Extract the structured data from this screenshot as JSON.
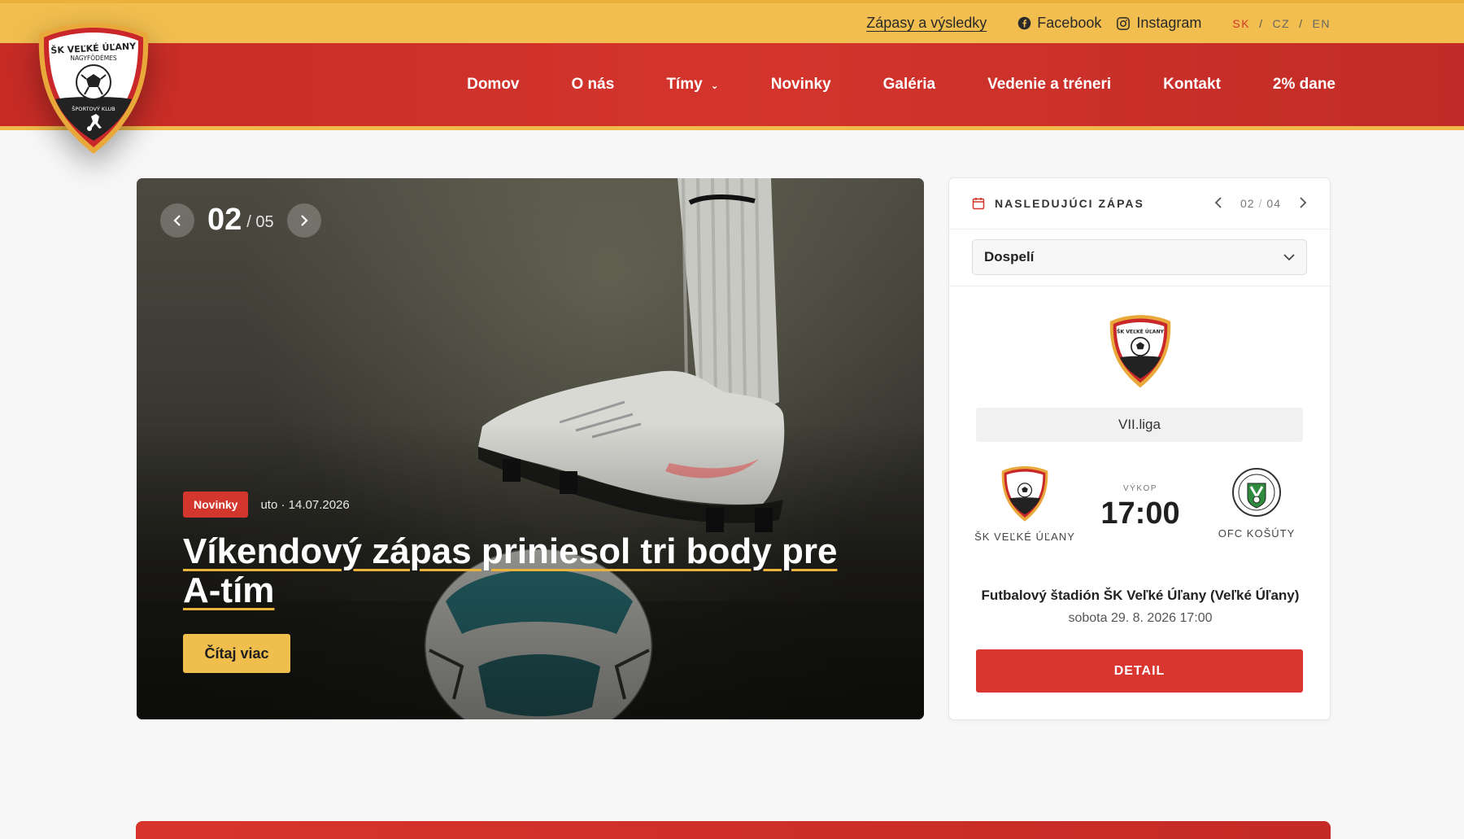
{
  "topbar": {
    "results_link": "Zápasy a výsledky",
    "facebook": "Facebook",
    "instagram": "Instagram",
    "languages": [
      "SK",
      "CZ",
      "EN"
    ],
    "active_language": "SK"
  },
  "nav": {
    "items": [
      {
        "label": "Domov"
      },
      {
        "label": "O nás"
      },
      {
        "label": "Tímy",
        "has_dropdown": true
      },
      {
        "label": "Novinky"
      },
      {
        "label": "Galéria"
      },
      {
        "label": "Vedenie a tréneri"
      },
      {
        "label": "Kontakt"
      },
      {
        "label": "2% dane"
      }
    ]
  },
  "logo": {
    "name_line1": "ŠK VEĽKÉ ÚĽANY",
    "name_line2": "NAGYFÖDÉMES",
    "motto": "ŠPORTOVÝ KLUB"
  },
  "hero": {
    "current": "02",
    "total": "/ 05",
    "tag": "Novinky",
    "date": "uto · 14.07.2026",
    "title": "Víkendový zápas priniesol tri body pre A-tím",
    "cta": "Čítaj viac"
  },
  "next_match": {
    "title": "NASLEDUJÚCI ZÁPAS",
    "page_current": "02",
    "page_sep": "/",
    "page_total": "04",
    "category": "Dospelí",
    "league": "VII.liga",
    "home_team": "ŠK VEĽKÉ ÚĽANY",
    "away_team": "OFC KOŠÚTY",
    "away_crest_text": "O.F.C. KOŠÚTY",
    "kickoff_label": "VÝKOP",
    "kickoff_time": "17:00",
    "venue": "Futbalový štadión ŠK Veľké Úľany (Veľké Úľany)",
    "datetime": "sobota 29. 8. 2026 17:00",
    "detail_button": "DETAIL"
  },
  "colors": {
    "brand_red": "#d3352c",
    "brand_yellow": "#f2be4f"
  }
}
